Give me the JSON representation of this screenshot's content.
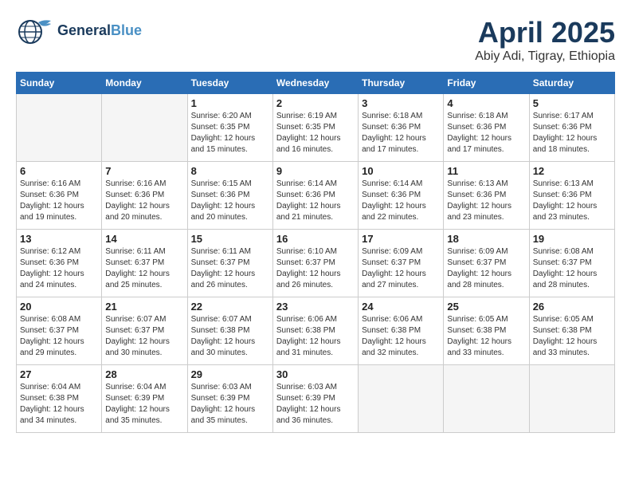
{
  "header": {
    "logo_general": "General",
    "logo_blue": "Blue",
    "month_year": "April 2025",
    "location": "Abiy Adi, Tigray, Ethiopia"
  },
  "weekdays": [
    "Sunday",
    "Monday",
    "Tuesday",
    "Wednesday",
    "Thursday",
    "Friday",
    "Saturday"
  ],
  "weeks": [
    [
      {
        "day": null,
        "sunrise": null,
        "sunset": null,
        "daylight": null
      },
      {
        "day": null,
        "sunrise": null,
        "sunset": null,
        "daylight": null
      },
      {
        "day": 1,
        "sunrise": "Sunrise: 6:20 AM",
        "sunset": "Sunset: 6:35 PM",
        "daylight": "Daylight: 12 hours and 15 minutes."
      },
      {
        "day": 2,
        "sunrise": "Sunrise: 6:19 AM",
        "sunset": "Sunset: 6:35 PM",
        "daylight": "Daylight: 12 hours and 16 minutes."
      },
      {
        "day": 3,
        "sunrise": "Sunrise: 6:18 AM",
        "sunset": "Sunset: 6:36 PM",
        "daylight": "Daylight: 12 hours and 17 minutes."
      },
      {
        "day": 4,
        "sunrise": "Sunrise: 6:18 AM",
        "sunset": "Sunset: 6:36 PM",
        "daylight": "Daylight: 12 hours and 17 minutes."
      },
      {
        "day": 5,
        "sunrise": "Sunrise: 6:17 AM",
        "sunset": "Sunset: 6:36 PM",
        "daylight": "Daylight: 12 hours and 18 minutes."
      }
    ],
    [
      {
        "day": 6,
        "sunrise": "Sunrise: 6:16 AM",
        "sunset": "Sunset: 6:36 PM",
        "daylight": "Daylight: 12 hours and 19 minutes."
      },
      {
        "day": 7,
        "sunrise": "Sunrise: 6:16 AM",
        "sunset": "Sunset: 6:36 PM",
        "daylight": "Daylight: 12 hours and 20 minutes."
      },
      {
        "day": 8,
        "sunrise": "Sunrise: 6:15 AM",
        "sunset": "Sunset: 6:36 PM",
        "daylight": "Daylight: 12 hours and 20 minutes."
      },
      {
        "day": 9,
        "sunrise": "Sunrise: 6:14 AM",
        "sunset": "Sunset: 6:36 PM",
        "daylight": "Daylight: 12 hours and 21 minutes."
      },
      {
        "day": 10,
        "sunrise": "Sunrise: 6:14 AM",
        "sunset": "Sunset: 6:36 PM",
        "daylight": "Daylight: 12 hours and 22 minutes."
      },
      {
        "day": 11,
        "sunrise": "Sunrise: 6:13 AM",
        "sunset": "Sunset: 6:36 PM",
        "daylight": "Daylight: 12 hours and 23 minutes."
      },
      {
        "day": 12,
        "sunrise": "Sunrise: 6:13 AM",
        "sunset": "Sunset: 6:36 PM",
        "daylight": "Daylight: 12 hours and 23 minutes."
      }
    ],
    [
      {
        "day": 13,
        "sunrise": "Sunrise: 6:12 AM",
        "sunset": "Sunset: 6:36 PM",
        "daylight": "Daylight: 12 hours and 24 minutes."
      },
      {
        "day": 14,
        "sunrise": "Sunrise: 6:11 AM",
        "sunset": "Sunset: 6:37 PM",
        "daylight": "Daylight: 12 hours and 25 minutes."
      },
      {
        "day": 15,
        "sunrise": "Sunrise: 6:11 AM",
        "sunset": "Sunset: 6:37 PM",
        "daylight": "Daylight: 12 hours and 26 minutes."
      },
      {
        "day": 16,
        "sunrise": "Sunrise: 6:10 AM",
        "sunset": "Sunset: 6:37 PM",
        "daylight": "Daylight: 12 hours and 26 minutes."
      },
      {
        "day": 17,
        "sunrise": "Sunrise: 6:09 AM",
        "sunset": "Sunset: 6:37 PM",
        "daylight": "Daylight: 12 hours and 27 minutes."
      },
      {
        "day": 18,
        "sunrise": "Sunrise: 6:09 AM",
        "sunset": "Sunset: 6:37 PM",
        "daylight": "Daylight: 12 hours and 28 minutes."
      },
      {
        "day": 19,
        "sunrise": "Sunrise: 6:08 AM",
        "sunset": "Sunset: 6:37 PM",
        "daylight": "Daylight: 12 hours and 28 minutes."
      }
    ],
    [
      {
        "day": 20,
        "sunrise": "Sunrise: 6:08 AM",
        "sunset": "Sunset: 6:37 PM",
        "daylight": "Daylight: 12 hours and 29 minutes."
      },
      {
        "day": 21,
        "sunrise": "Sunrise: 6:07 AM",
        "sunset": "Sunset: 6:37 PM",
        "daylight": "Daylight: 12 hours and 30 minutes."
      },
      {
        "day": 22,
        "sunrise": "Sunrise: 6:07 AM",
        "sunset": "Sunset: 6:38 PM",
        "daylight": "Daylight: 12 hours and 30 minutes."
      },
      {
        "day": 23,
        "sunrise": "Sunrise: 6:06 AM",
        "sunset": "Sunset: 6:38 PM",
        "daylight": "Daylight: 12 hours and 31 minutes."
      },
      {
        "day": 24,
        "sunrise": "Sunrise: 6:06 AM",
        "sunset": "Sunset: 6:38 PM",
        "daylight": "Daylight: 12 hours and 32 minutes."
      },
      {
        "day": 25,
        "sunrise": "Sunrise: 6:05 AM",
        "sunset": "Sunset: 6:38 PM",
        "daylight": "Daylight: 12 hours and 33 minutes."
      },
      {
        "day": 26,
        "sunrise": "Sunrise: 6:05 AM",
        "sunset": "Sunset: 6:38 PM",
        "daylight": "Daylight: 12 hours and 33 minutes."
      }
    ],
    [
      {
        "day": 27,
        "sunrise": "Sunrise: 6:04 AM",
        "sunset": "Sunset: 6:38 PM",
        "daylight": "Daylight: 12 hours and 34 minutes."
      },
      {
        "day": 28,
        "sunrise": "Sunrise: 6:04 AM",
        "sunset": "Sunset: 6:39 PM",
        "daylight": "Daylight: 12 hours and 35 minutes."
      },
      {
        "day": 29,
        "sunrise": "Sunrise: 6:03 AM",
        "sunset": "Sunset: 6:39 PM",
        "daylight": "Daylight: 12 hours and 35 minutes."
      },
      {
        "day": 30,
        "sunrise": "Sunrise: 6:03 AM",
        "sunset": "Sunset: 6:39 PM",
        "daylight": "Daylight: 12 hours and 36 minutes."
      },
      {
        "day": null,
        "sunrise": null,
        "sunset": null,
        "daylight": null
      },
      {
        "day": null,
        "sunrise": null,
        "sunset": null,
        "daylight": null
      },
      {
        "day": null,
        "sunrise": null,
        "sunset": null,
        "daylight": null
      }
    ]
  ]
}
